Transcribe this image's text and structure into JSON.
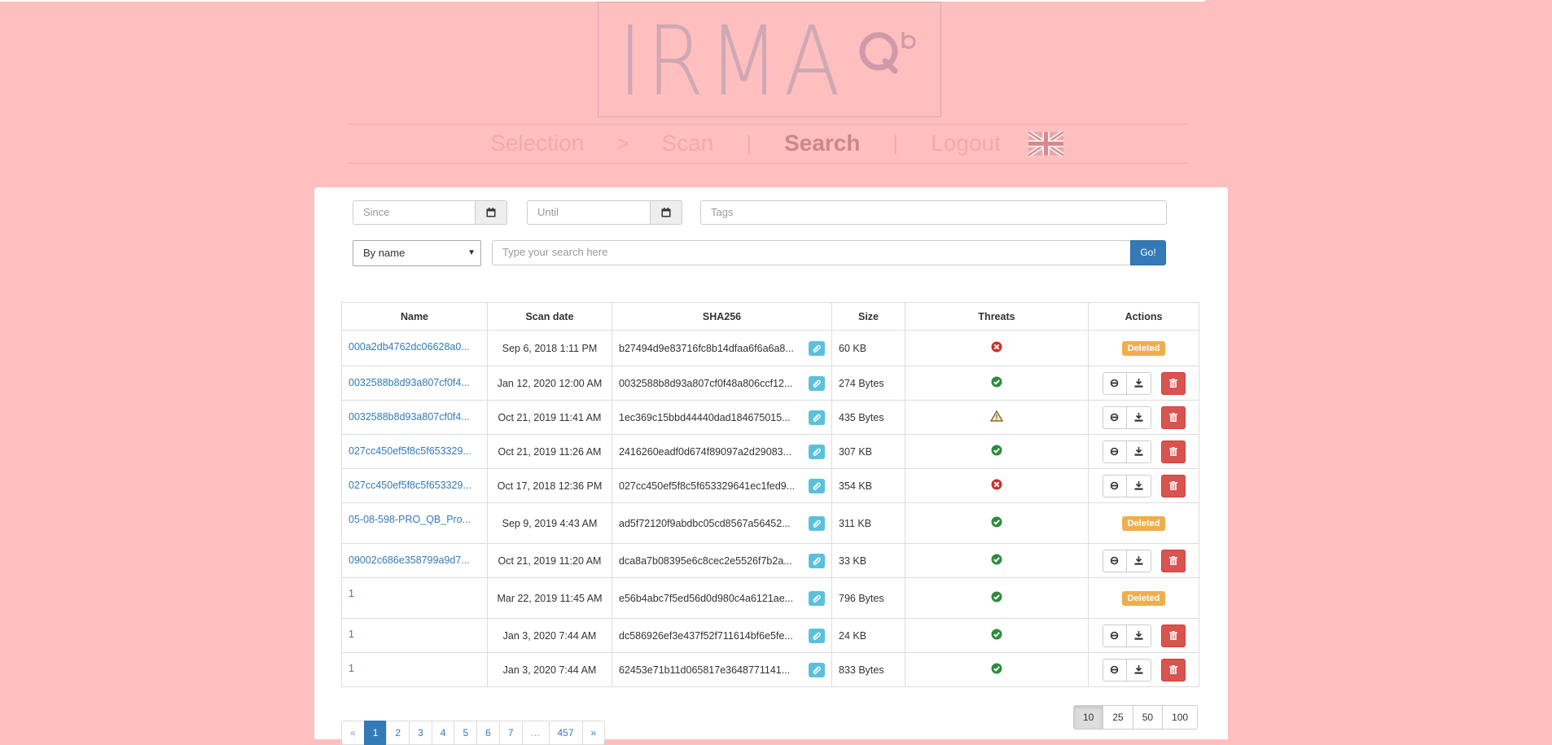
{
  "header": {
    "logo_text": "IRMA",
    "logo_mark": "QB",
    "nav": [
      {
        "label": "Selection",
        "active": false
      },
      {
        "label": "Scan",
        "active": false
      },
      {
        "label": "Search",
        "active": true
      },
      {
        "label": "Logout",
        "active": false
      }
    ],
    "nav_separators": [
      ">",
      "|",
      "|"
    ],
    "language_icon": "uk-flag-icon"
  },
  "filters": {
    "since_placeholder": "Since",
    "until_placeholder": "Until",
    "tags_placeholder": "Tags",
    "search_type": "By name",
    "search_placeholder": "Type your search here",
    "go_label": "Go!",
    "calendar_icon": "calendar-icon"
  },
  "table": {
    "headers": [
      "Name",
      "Scan date",
      "SHA256",
      "Size",
      "Threats",
      "Actions"
    ],
    "deleted_label": "Deleted",
    "rows": [
      {
        "name": "000a2db4762dc06628a0...",
        "date": "Sep 6, 2018 1:11 PM",
        "sha": "b27494d9e83716fc8b14dfaa6f6a6a8...",
        "size": "60 KB",
        "threat": "infected",
        "deleted": true
      },
      {
        "name": "0032588b8d93a807cf0f4...",
        "date": "Jan 12, 2020 12:00 AM",
        "sha": "0032588b8d93a807cf0f48a806ccf12...",
        "size": "274 Bytes",
        "threat": "clean",
        "deleted": false
      },
      {
        "name": "0032588b8d93a807cf0f4...",
        "date": "Oct 21, 2019 11:41 AM",
        "sha": "1ec369c15bbd44440dad184675015...",
        "size": "435 Bytes",
        "threat": "warning",
        "deleted": false
      },
      {
        "name": "027cc450ef5f8c5f653329...",
        "date": "Oct 21, 2019 11:26 AM",
        "sha": "2416260eadf0d674f89097a2d29083...",
        "size": "307 KB",
        "threat": "clean",
        "deleted": false
      },
      {
        "name": "027cc450ef5f8c5f653329...",
        "date": "Oct 17, 2018 12:36 PM",
        "sha": "027cc450ef5f8c5f653329641ec1fed9...",
        "size": "354 KB",
        "threat": "infected",
        "deleted": false
      },
      {
        "name": "05-08-598-PRO_QB_Pro...",
        "date": "Sep 9, 2019 4:43 AM",
        "sha": "ad5f72120f9abdbc05cd8567a56452...",
        "size": "311 KB",
        "threat": "clean",
        "deleted": true
      },
      {
        "name": "09002c686e358799a9d7...",
        "date": "Oct 21, 2019 11:20 AM",
        "sha": "dca8a7b08395e6c8cec2e5526f7b2a...",
        "size": "33 KB",
        "threat": "clean",
        "deleted": false
      },
      {
        "name": "1",
        "date": "Mar 22, 2019 11:45 AM",
        "sha": "e56b4abc7f5ed56d0d980c4a6121ae...",
        "size": "796 Bytes",
        "threat": "clean",
        "deleted": true
      },
      {
        "name": "1",
        "date": "Jan 3, 2020 7:44 AM",
        "sha": "dc586926ef3e437f52f711614bf6e5fe...",
        "size": "24 KB",
        "threat": "clean",
        "deleted": false
      },
      {
        "name": "1",
        "date": "Jan 3, 2020 7:44 AM",
        "sha": "62453e71b11d065817e3648771141...",
        "size": "833 Bytes",
        "threat": "clean",
        "deleted": false
      }
    ]
  },
  "pagination": {
    "pages": [
      "«",
      "1",
      "2",
      "3",
      "4",
      "5",
      "6",
      "7",
      "…",
      "457",
      "»"
    ],
    "active": "1",
    "disabled": [
      "«",
      "…"
    ]
  },
  "page_sizes": {
    "options": [
      "10",
      "25",
      "50",
      "100"
    ],
    "active": "10"
  },
  "colors": {
    "background": "#ffbfbf",
    "primary": "#337ab7",
    "info": "#5bc0de",
    "danger": "#d9534f",
    "warning": "#f0ad4e",
    "success": "#2e8b3e"
  }
}
